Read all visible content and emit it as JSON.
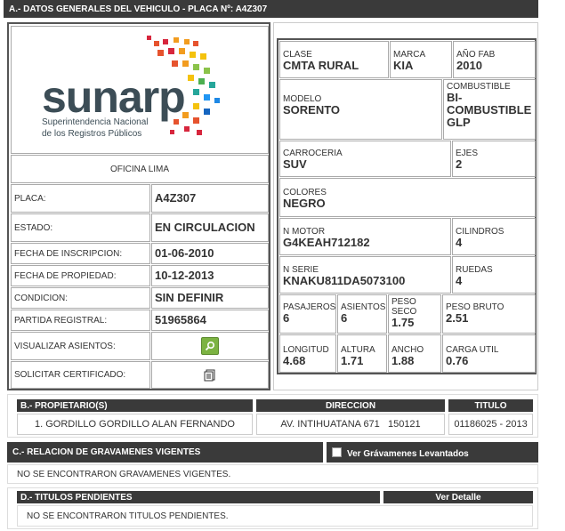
{
  "section_a": {
    "title": "A.- DATOS GENERALES DEL VEHICULO - PLACA Nº: A4Z307",
    "logo": {
      "wordmark": "sunarp",
      "line1": "Superintendencia Nacional",
      "line2": "de los Registros Públicos"
    },
    "office": "OFICINA LIMA",
    "left_rows": [
      {
        "label": "PLACA:",
        "value": "A4Z307"
      },
      {
        "label": "ESTADO:",
        "value": "EN CIRCULACION"
      },
      {
        "label": "FECHA DE INSCRIPCION:",
        "value": "01-06-2010"
      },
      {
        "label": "FECHA DE PROPIEDAD:",
        "value": "10-12-2013"
      },
      {
        "label": "CONDICION:",
        "value": "SIN DEFINIR"
      },
      {
        "label": "PARTIDA REGISTRAL:",
        "value": "51965864"
      }
    ],
    "visualizar_label": "VISUALIZAR ASIENTOS:",
    "solicitar_label": "SOLICITAR CERTIFICADO:",
    "clase": {
      "label": "CLASE",
      "value": "CMTA RURAL"
    },
    "marca": {
      "label": "MARCA",
      "value": "KIA"
    },
    "anio": {
      "label": "AÑO FAB",
      "value": "2010"
    },
    "modelo": {
      "label": "MODELO",
      "value": "SORENTO"
    },
    "combustible": {
      "label": "COMBUSTIBLE",
      "value1": "BI-",
      "value2": "COMBUSTIBLE",
      "value3": "GLP"
    },
    "carroceria": {
      "label": "CARROCERIA",
      "value": "SUV"
    },
    "ejes": {
      "label": "EJES",
      "value": "2"
    },
    "colores": {
      "label": "COLORES",
      "value": "NEGRO"
    },
    "motor": {
      "label": "N MOTOR",
      "value": "G4KEAH712182"
    },
    "cilindros": {
      "label": "CILINDROS",
      "value": "4"
    },
    "serie": {
      "label": "N SERIE",
      "value": "KNAKU811DA5073100"
    },
    "ruedas": {
      "label": "RUEDAS",
      "value": "4"
    },
    "pasajeros": {
      "label": "PASAJEROS",
      "value": "6"
    },
    "asientos": {
      "label": "ASIENTOS",
      "value": "6"
    },
    "peso_seco": {
      "label1": "PESO",
      "label2": "SECO",
      "value": "1.75"
    },
    "peso_bruto": {
      "label": "PESO BRUTO",
      "value": "2.51"
    },
    "longitud": {
      "label": "LONGITUD",
      "value": "4.68"
    },
    "altura": {
      "label": "ALTURA",
      "value": "1.71"
    },
    "ancho": {
      "label": "ANCHO",
      "value": "1.88"
    },
    "carga_util": {
      "label": "CARGA UTIL",
      "value": "0.76"
    }
  },
  "section_b": {
    "headers": [
      "B.- PROPIETARIO(S)",
      "DIRECCION",
      "TITULO"
    ],
    "row": [
      "1. GORDILLO GORDILLO ALAN FERNANDO",
      "AV. INTIHUATANA 671   150121",
      "01186025 - 2013"
    ]
  },
  "section_c": {
    "title": "C.- RELACION DE GRAVAMENES VIGENTES",
    "checkbox_label": "Ver Grávamenes Levantados",
    "message": "NO SE ENCONTRARON GRAVAMENES VIGENTES."
  },
  "section_d": {
    "title": "D.- TITULOS PENDIENTES",
    "detail_label": "Ver Detalle",
    "message": "NO SE ENCONTRARON TITULOS PENDIENTES."
  },
  "colors": {
    "header_bg": "#3a3a3a",
    "search_button": "#7cb342"
  }
}
